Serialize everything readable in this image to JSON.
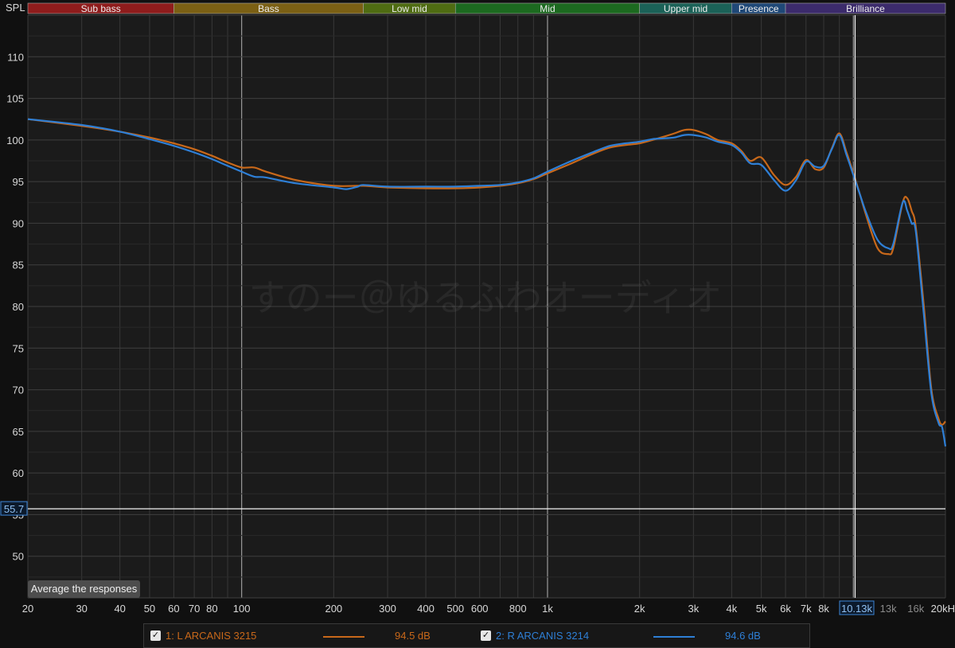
{
  "chart_data": {
    "type": "line",
    "y_axis_title": "SPL",
    "x_scale": "log",
    "xlim": [
      20,
      20000
    ],
    "ylim": [
      45,
      115
    ],
    "y_ticks": [
      50,
      55,
      60,
      65,
      70,
      75,
      80,
      85,
      90,
      95,
      100,
      105,
      110
    ],
    "x_ticks": [
      {
        "value": 20,
        "label": "20"
      },
      {
        "value": 30,
        "label": "30"
      },
      {
        "value": 40,
        "label": "40"
      },
      {
        "value": 50,
        "label": "50"
      },
      {
        "value": 60,
        "label": "60"
      },
      {
        "value": 70,
        "label": "70"
      },
      {
        "value": 80,
        "label": "80"
      },
      {
        "value": 100,
        "label": "100"
      },
      {
        "value": 200,
        "label": "200"
      },
      {
        "value": 300,
        "label": "300"
      },
      {
        "value": 400,
        "label": "400"
      },
      {
        "value": 500,
        "label": "500"
      },
      {
        "value": 600,
        "label": "600"
      },
      {
        "value": 800,
        "label": "800"
      },
      {
        "value": 1000,
        "label": "1k"
      },
      {
        "value": 2000,
        "label": "2k"
      },
      {
        "value": 3000,
        "label": "3k"
      },
      {
        "value": 4000,
        "label": "4k"
      },
      {
        "value": 5000,
        "label": "5k"
      },
      {
        "value": 6000,
        "label": "6k"
      },
      {
        "value": 7000,
        "label": "7k"
      },
      {
        "value": 8000,
        "label": "8k"
      },
      {
        "value": 13000,
        "label": "13k",
        "dim": true
      },
      {
        "value": 16000,
        "label": "16k",
        "dim": true
      },
      {
        "value": 20000,
        "label": "20kH"
      }
    ],
    "grid": true,
    "bands": [
      {
        "label": "Sub bass",
        "from": 20,
        "to": 60,
        "color": "#8f1c1c"
      },
      {
        "label": "Bass",
        "from": 60,
        "to": 250,
        "color": "#7b6014"
      },
      {
        "label": "Low mid",
        "from": 250,
        "to": 500,
        "color": "#4f6c12"
      },
      {
        "label": "Mid",
        "from": 500,
        "to": 2000,
        "color": "#1c6a20"
      },
      {
        "label": "Upper mid",
        "from": 2000,
        "to": 4000,
        "color": "#1b6258"
      },
      {
        "label": "Presence",
        "from": 4000,
        "to": 6000,
        "color": "#1f4877"
      },
      {
        "label": "Brilliance",
        "from": 6000,
        "to": 20000,
        "color": "#3c2b6c"
      }
    ],
    "cursor": {
      "x": 10130,
      "x_label": "10.13k",
      "y": 55.7,
      "y_label": "55.7"
    },
    "watermark": "すのー＠ゆるふわオーディオ",
    "series": [
      {
        "name": "1: L ARCANIS 3215",
        "color": "#c8681a",
        "value_label": "94.5 dB",
        "x": [
          20,
          30,
          40,
          50,
          60,
          70,
          80,
          90,
          100,
          110,
          120,
          150,
          200,
          250,
          300,
          400,
          500,
          600,
          700,
          800,
          900,
          1000,
          1200,
          1400,
          1600,
          1800,
          2000,
          2200,
          2400,
          2600,
          2800,
          3000,
          3300,
          3600,
          4000,
          4300,
          4600,
          5000,
          5500,
          6000,
          6500,
          7000,
          7500,
          8000,
          8500,
          9000,
          9500,
          10000,
          10500,
          11000,
          12000,
          13000,
          13500,
          14500,
          15000,
          15500,
          16000,
          17000,
          18000,
          19000,
          19500,
          20000
        ],
        "y": [
          102.5,
          101.7,
          101.0,
          100.3,
          99.6,
          98.9,
          98.1,
          97.3,
          96.7,
          96.7,
          96.2,
          95.2,
          94.5,
          94.5,
          94.3,
          94.2,
          94.2,
          94.3,
          94.5,
          94.8,
          95.3,
          96.0,
          97.2,
          98.3,
          99.1,
          99.4,
          99.6,
          100.0,
          100.4,
          100.8,
          101.2,
          101.2,
          100.7,
          100.0,
          99.6,
          98.7,
          97.5,
          97.9,
          95.8,
          94.6,
          95.6,
          97.6,
          96.5,
          96.7,
          99.0,
          100.8,
          98.5,
          96.0,
          93.5,
          91.0,
          87.0,
          86.3,
          87.0,
          92.5,
          93.0,
          91.5,
          89.5,
          80.0,
          70.0,
          66.5,
          65.8,
          66.2
        ]
      },
      {
        "name": "2: R ARCANIS 3214",
        "color": "#2e7fd6",
        "value_label": "94.6 dB",
        "x": [
          20,
          30,
          40,
          50,
          60,
          70,
          80,
          90,
          100,
          110,
          120,
          150,
          200,
          220,
          240,
          250,
          300,
          400,
          500,
          600,
          700,
          800,
          900,
          1000,
          1200,
          1400,
          1600,
          1800,
          2000,
          2200,
          2400,
          2600,
          2800,
          3000,
          3300,
          3600,
          4000,
          4300,
          4600,
          5000,
          5500,
          6000,
          6500,
          7000,
          7500,
          8000,
          8500,
          9000,
          9500,
          10000,
          10500,
          11000,
          12000,
          13000,
          13500,
          14500,
          15000,
          15500,
          16000,
          17000,
          18000,
          19000,
          19500,
          20000
        ],
        "y": [
          102.5,
          101.8,
          101.0,
          100.1,
          99.3,
          98.5,
          97.7,
          96.9,
          96.2,
          95.6,
          95.5,
          94.8,
          94.3,
          94.1,
          94.4,
          94.6,
          94.4,
          94.4,
          94.4,
          94.5,
          94.6,
          94.9,
          95.4,
          96.2,
          97.5,
          98.5,
          99.3,
          99.6,
          99.8,
          100.1,
          100.2,
          100.3,
          100.6,
          100.6,
          100.3,
          99.8,
          99.4,
          98.5,
          97.2,
          97.0,
          95.2,
          93.9,
          95.2,
          97.4,
          96.8,
          96.9,
          98.9,
          100.6,
          98.2,
          95.8,
          93.5,
          91.3,
          88.0,
          87.0,
          87.5,
          92.5,
          91.5,
          90.0,
          89.0,
          79.0,
          69.5,
          66.0,
          65.5,
          63.2
        ]
      }
    ]
  },
  "controls": {
    "average_button": "Average the responses"
  }
}
